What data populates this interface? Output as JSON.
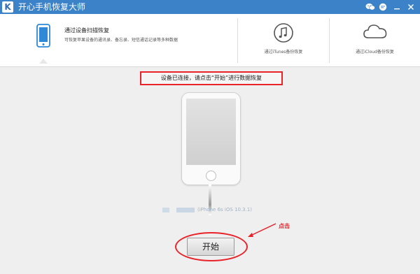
{
  "app": {
    "title": "开心手机恢复大师",
    "logo_letter": "K"
  },
  "modes": {
    "scan": {
      "title": "通过设备扫描恢复",
      "desc": "可恢复苹果设备的通讯录、备忘录、短信通话记录等多种数据"
    },
    "itunes": {
      "label": "通过iTunes备份恢复"
    },
    "icloud": {
      "label": "通过iCloud备份恢复"
    }
  },
  "main": {
    "status": "设备已连接，请点击“开始”进行数据恢复",
    "device_info": "(iPhone 6s iOS 10.3.1)",
    "start_button": "开始",
    "annotation": "点击"
  },
  "colors": {
    "titlebar": "#3b82c8",
    "accent": "#e8232a"
  },
  "icons": [
    "logo-icon",
    "wechat-icon",
    "message-icon",
    "minimize-icon",
    "close-icon",
    "phone-icon",
    "music-note-icon",
    "cloud-icon"
  ]
}
